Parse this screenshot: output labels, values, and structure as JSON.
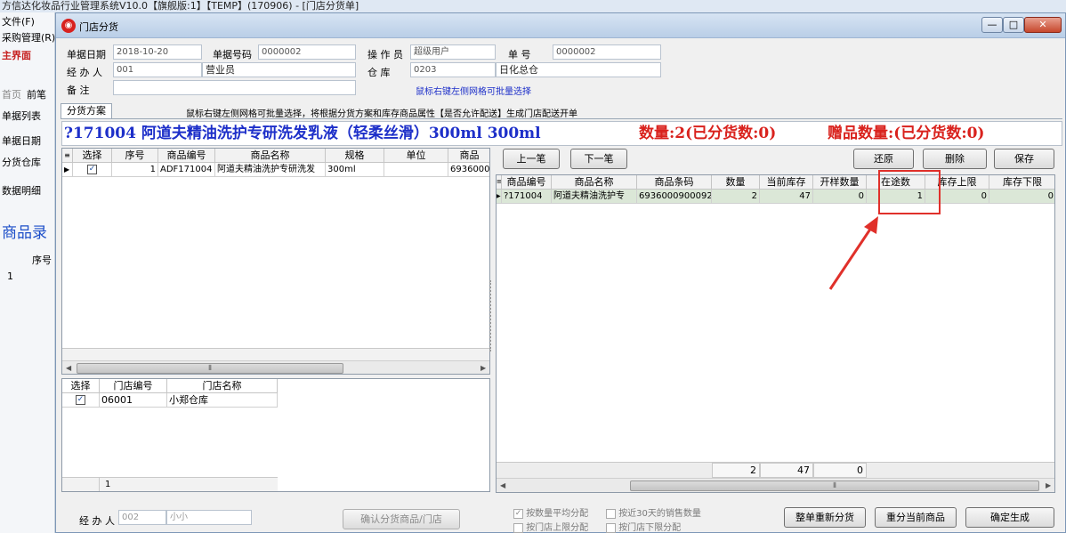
{
  "outer": {
    "title": "方信达化妆品行业管理系统V10.0【旗舰版:1】【TEMP】(170906) - [门店分货单]",
    "menu_file": "文件(F)",
    "menu_purchase": "采购管理(R)",
    "home_tab": "主界面",
    "nav_first": "首页",
    "nav_prev": "前笔",
    "list_title": "单据列表",
    "field_date": "单据日期",
    "field_warehouse": "分货仓库",
    "data_detail": "数据明细",
    "product_entry": "商品录",
    "col_seq": "序号",
    "row_num": "1"
  },
  "window": {
    "title": "门店分货",
    "btn_min": "—",
    "btn_max": "□",
    "btn_close": "✕"
  },
  "header": {
    "date_label": "单据日期",
    "date_value": "2018-10-20",
    "docno_label": "单据号码",
    "docno_value": "0000002",
    "operator_label": "操 作 员",
    "operator_value": "超级用户",
    "no_label": "单      号",
    "no_value": "0000002",
    "handler_label": "经 办 人",
    "handler_code": "001",
    "handler_name": "营业员",
    "warehouse_label": "仓      库",
    "warehouse_code": "0203",
    "warehouse_name": "日化总仓",
    "remark_label": "备      注",
    "remark_value": "",
    "hint_right_click": "鼠标右键左侧网格可批量选择"
  },
  "tabs": {
    "plan_tab": "分货方案",
    "instruction": "鼠标右键左侧网格可批量选择，将根据分货方案和库存商品属性【是否允许配送】生成门店配送开单"
  },
  "summary": {
    "product_line": "?171004   阿道夫精油洗护专研洗发乳液（轻柔丝滑）300ml   300ml",
    "qty_text": "数量:2(已分货数:0)",
    "gift_text": "赠品数量:(已分货数:0)"
  },
  "left_grid": {
    "columns": [
      "选择",
      "序号",
      "商品编号",
      "商品名称",
      "规格",
      "单位",
      "商品"
    ],
    "rows": [
      {
        "checked": "✓",
        "seq": "1",
        "code": "ADF171004",
        "name": "阿道夫精油洗护专研洗发",
        "spec": "300ml",
        "unit": "",
        "barcode": "6936000"
      }
    ]
  },
  "store_grid": {
    "columns": [
      "选择",
      "门店编号",
      "门店名称"
    ],
    "rows": [
      {
        "checked": "✓",
        "code": "06001",
        "name": "小郑仓库"
      }
    ],
    "footer_count": "1"
  },
  "right_buttons": {
    "prev": "上一笔",
    "next": "下一笔",
    "restore": "还原",
    "delete": "删除",
    "save": "保存"
  },
  "right_grid": {
    "columns": [
      "商品编号",
      "商品名称",
      "商品条码",
      "数量",
      "当前库存",
      "开样数量",
      "在途数",
      "库存上限",
      "库存下限"
    ],
    "rows": [
      {
        "code": "?171004",
        "name": "阿道夫精油洗护专",
        "barcode": "6936000900092",
        "qty": "2",
        "stock": "47",
        "sample": "0",
        "transit": "1",
        "upper": "0",
        "lower": "0"
      }
    ],
    "totals": {
      "qty": "2",
      "stock": "47",
      "sample": "0"
    }
  },
  "options": {
    "avg_by_qty": "按数量平均分配",
    "recent_30": "按近30天的销售数量",
    "upper_limit": "按门店上限分配",
    "lower_limit": "按门店下限分配",
    "avg_checked": "✓"
  },
  "footer": {
    "handler_label": "经 办 人",
    "handler_code": "002",
    "handler_name": "小小",
    "confirm_btn": "确认分货商品/门店",
    "redistribute_all": "整单重新分货",
    "redistribute_current": "重分当前商品",
    "confirm_generate": "确定生成"
  },
  "colors": {
    "summary_blue": "#1d2fc9",
    "summary_red": "#d9221d",
    "highlight_red": "#e0302a"
  }
}
